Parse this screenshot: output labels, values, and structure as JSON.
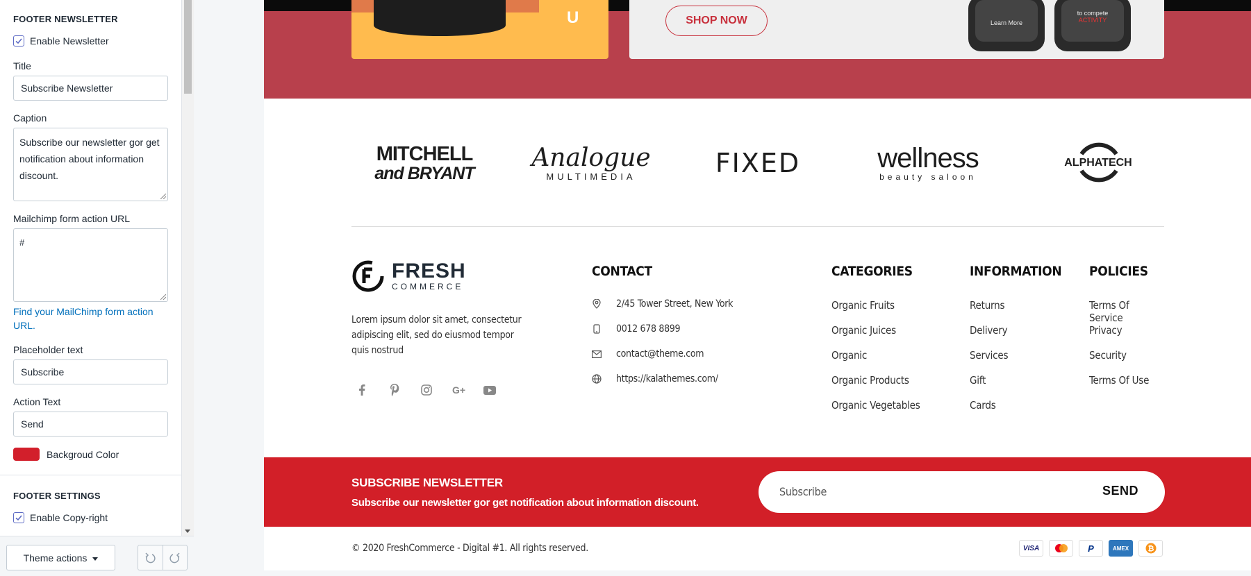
{
  "sidebar": {
    "newsletter_section": {
      "heading": "FOOTER NEWSLETTER",
      "enable_label": "Enable Newsletter",
      "title_label": "Title",
      "title_value": "Subscribe Newsletter",
      "caption_label": "Caption",
      "caption_value": "Subscribe our newsletter gor get notification about information discount.",
      "mailchimp_label": "Mailchimp form action URL",
      "mailchimp_value": "#",
      "mailchimp_help_link": "Find your MailChimp form action URL.",
      "placeholder_label": "Placeholder text",
      "placeholder_value": "Subscribe",
      "action_label": "Action Text",
      "action_value": "Send",
      "bg_color_label": "Backgroud Color",
      "bg_color": "#d21f2b"
    },
    "footer_settings": {
      "heading": "FOOTER SETTINGS",
      "enable_copyright_label": "Enable Copy-right"
    },
    "footer_bar": {
      "theme_actions_label": "Theme actions",
      "undo_icon": "undo-icon",
      "redo_icon": "redo-icon"
    }
  },
  "preview": {
    "promo": {
      "shop_now": "SHOP NOW",
      "watch_left_text": "Learn More",
      "watch_right_text": "to compete",
      "watch_right_sub": "ACTIVITY"
    },
    "brands": [
      {
        "line1": "MITCHELL",
        "line2": "and BRYANT"
      },
      {
        "line1": "Analogue",
        "line2": "MULTIMEDIA"
      },
      {
        "line1": "FIXED",
        "line2": ""
      },
      {
        "line1": "wellness",
        "line2": "beauty saloon"
      },
      {
        "line1": "ALPHATECH",
        "line2": ""
      }
    ],
    "logo": {
      "name": "FRESH",
      "sub": "COMMERCE"
    },
    "about": "Lorem ipsum dolor sit amet, consectetur adipiscing elit, sed do eiusmod tempor quis nostrud",
    "socials": [
      "facebook-icon",
      "pinterest-icon",
      "instagram-icon",
      "google-plus-icon",
      "youtube-icon"
    ],
    "contact": {
      "title": "CONTACT",
      "address": "2/45 Tower Street, New York",
      "phone": "0012 678 8899",
      "email": "contact@theme.com",
      "website": "https://kalathemes.com/"
    },
    "categories": {
      "title": "CATEGORIES",
      "items": [
        "Organic Fruits",
        "Organic Juices",
        "Organic",
        "Organic Products",
        "Organic Vegetables"
      ]
    },
    "information": {
      "title": "INFORMATION",
      "items": [
        "Returns",
        "Delivery",
        "Services",
        "Gift",
        "Cards"
      ]
    },
    "policies": {
      "title": "POLICIES",
      "items": [
        "Terms Of Service",
        "Privacy",
        "Security",
        "Terms Of Use"
      ]
    },
    "newsletter": {
      "title": "SUBSCRIBE NEWSLETTER",
      "caption": "Subscribe our newsletter gor get notification about information discount.",
      "placeholder": "Subscribe",
      "button": "SEND",
      "bg_color": "#d21f28"
    },
    "copyright": "© 2020 FreshCommerce - Digital #1. All rights reserved.",
    "payments": [
      "VISA",
      "mastercard",
      "PayPal",
      "AMEX",
      "bitcoin"
    ]
  }
}
